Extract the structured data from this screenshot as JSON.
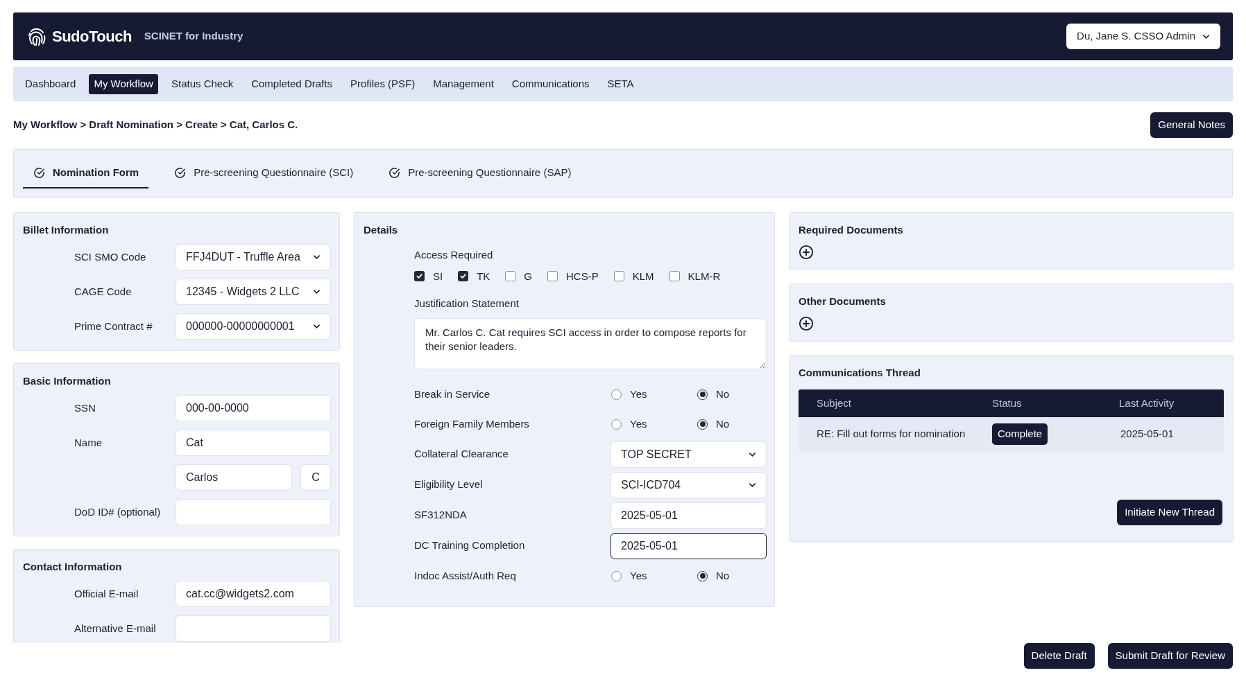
{
  "header": {
    "brand": "SudoTouch",
    "subtitle": "SCINET for Industry",
    "user_menu": "Du, Jane S. CSSO Admin"
  },
  "nav": [
    {
      "label": "Dashboard",
      "selected": false
    },
    {
      "label": "My Workflow",
      "selected": true
    },
    {
      "label": "Status Check",
      "selected": false
    },
    {
      "label": "Completed Drafts",
      "selected": false
    },
    {
      "label": "Profiles (PSF)",
      "selected": false
    },
    {
      "label": "Management",
      "selected": false
    },
    {
      "label": "Communications",
      "selected": false
    },
    {
      "label": "SETA",
      "selected": false
    }
  ],
  "breadcrumb": "My Workflow > Draft Nomination > Create > Cat, Carlos C.",
  "general_notes_button": "General Notes",
  "form_tabs": [
    {
      "label": "Nomination Form",
      "selected": true
    },
    {
      "label": "Pre-screening Questionnaire (SCI)",
      "selected": false
    },
    {
      "label": "Pre-screening Questionnaire (SAP)",
      "selected": false
    }
  ],
  "left_panels": [
    {
      "title": "Billet Information",
      "fields": [
        {
          "label": "SCI SMO Code",
          "kind": "select",
          "value": "FFJ4DUT - Truffle Area"
        },
        {
          "label": "CAGE Code",
          "kind": "select",
          "value": "12345 - Widgets 2 LLC"
        },
        {
          "label": "Prime Contract #",
          "kind": "select",
          "value": "000000-00000000001"
        }
      ]
    },
    {
      "title": "Basic Information",
      "fields": [
        {
          "label": "SSN",
          "kind": "text",
          "value": "000-00-0000"
        },
        {
          "label": "Name",
          "kind": "text",
          "value": "Cat"
        },
        {
          "kind": "pair",
          "value": "Carlos",
          "value_2": "C"
        },
        {
          "label": "DoD ID# (optional)",
          "kind": "text"
        }
      ]
    },
    {
      "title": "Contact Information",
      "fields": [
        {
          "label": "Official E-mail",
          "kind": "text",
          "value": "cat.cc@widgets2.com"
        },
        {
          "label": "Alternative E-mail",
          "kind": "text"
        }
      ]
    }
  ],
  "details": {
    "title": "Details",
    "access_label": "Access Required",
    "access": [
      {
        "label": "SI",
        "checked": true
      },
      {
        "label": "TK",
        "checked": true
      },
      {
        "label": "G",
        "checked": false
      },
      {
        "label": "HCS-P",
        "checked": false
      },
      {
        "label": "KLM",
        "checked": false
      },
      {
        "label": "KLM-R",
        "checked": false
      }
    ],
    "justification_label": "Justification Statement",
    "justification": "Mr. Carlos C. Cat requires SCI access in order to compose reports for their senior leaders.",
    "rows": [
      {
        "label": "Break in Service",
        "kind": "radio",
        "options": [
          {
            "label": "Yes",
            "selected": false
          },
          {
            "label": "No",
            "selected": true
          }
        ]
      },
      {
        "label": "Foreign Family Members",
        "kind": "radio",
        "options": [
          {
            "label": "Yes",
            "selected": false
          },
          {
            "label": "No",
            "selected": true
          }
        ]
      },
      {
        "label": "Collateral Clearance",
        "kind": "select",
        "value": "TOP SECRET"
      },
      {
        "label": "Eligibility Level",
        "kind": "select",
        "value": "SCI-ICD704"
      },
      {
        "label": "SF312NDA",
        "kind": "text",
        "value": "2025-05-01",
        "focused": false
      },
      {
        "label": "DC Training Completion",
        "kind": "text",
        "value": "2025-05-01",
        "focused": true
      },
      {
        "label": "Indoc Assist/Auth Req",
        "kind": "radio",
        "options": [
          {
            "label": "Yes",
            "selected": false
          },
          {
            "label": "No",
            "selected": true
          }
        ]
      }
    ]
  },
  "required_documents": {
    "title": "Required Documents"
  },
  "other_documents": {
    "title": "Other Documents"
  },
  "communications": {
    "title": "Communications Thread",
    "columns": [
      "Subject",
      "Status",
      "Last Activity"
    ],
    "rows": [
      {
        "subject": "RE: Fill out forms for nomination",
        "status": "Complete",
        "last_activity": "2025-05-01"
      }
    ],
    "button": "Initiate New Thread"
  },
  "footer_buttons": [
    "Delete Draft",
    "Submit Draft for Review"
  ]
}
